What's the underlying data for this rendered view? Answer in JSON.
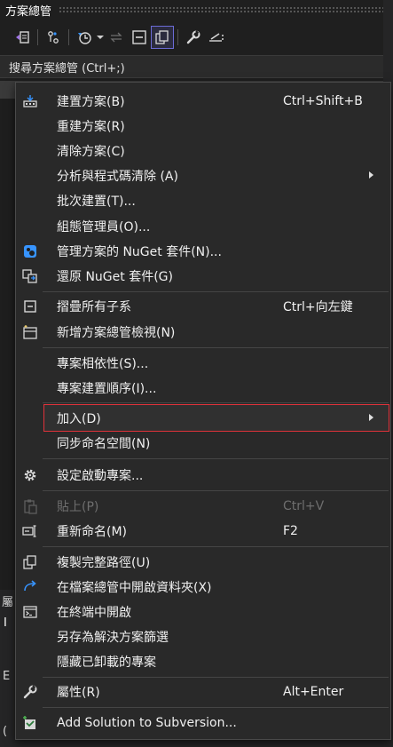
{
  "panel": {
    "title": "方案總管",
    "search_placeholder": "搜尋方案總管 (Ctrl+;)"
  },
  "background_fragments": {
    "a": "屬",
    "b": "I",
    "c": "E",
    "d": "(",
    "e": "C"
  },
  "menu": {
    "build": {
      "label": "建置方案(B)",
      "shortcut": "Ctrl+Shift+B"
    },
    "rebuild": {
      "label": "重建方案(R)"
    },
    "clean": {
      "label": "清除方案(C)"
    },
    "analyze": {
      "label": "分析與程式碼清除 (A)"
    },
    "batch_build": {
      "label": "批次建置(T)..."
    },
    "config_manager": {
      "label": "組態管理員(O)..."
    },
    "manage_nuget": {
      "label": "管理方案的 NuGet 套件(N)..."
    },
    "restore_nuget": {
      "label": "還原 NuGet 套件(G)"
    },
    "collapse_all": {
      "label": "摺疊所有子系",
      "shortcut": "Ctrl+向左鍵"
    },
    "new_view": {
      "label": "新增方案總管檢視(N)"
    },
    "dependencies": {
      "label": "專案相依性(S)..."
    },
    "build_order": {
      "label": "專案建置順序(I)..."
    },
    "add": {
      "label": "加入(D)"
    },
    "sync_namespaces": {
      "label": "同步命名空間(N)"
    },
    "set_startup": {
      "label": "設定啟動專案..."
    },
    "paste": {
      "label": "貼上(P)",
      "shortcut": "Ctrl+V"
    },
    "rename": {
      "label": "重新命名(M)",
      "shortcut": "F2"
    },
    "copy_path": {
      "label": "複製完整路徑(U)"
    },
    "open_folder": {
      "label": "在檔案總管中開啟資料夾(X)"
    },
    "open_terminal": {
      "label": "在終端中開啟"
    },
    "save_filter": {
      "label": "另存為解決方案篩選"
    },
    "hide_unloaded": {
      "label": "隱藏已卸載的專案"
    },
    "properties": {
      "label": "屬性(R)",
      "shortcut": "Alt+Enter"
    },
    "add_svn": {
      "label": "Add Solution to Subversion..."
    }
  },
  "colors": {
    "highlight_border": "#e0323a",
    "accent_blue": "#3794ff",
    "accent_purple": "#8a6bd6"
  }
}
